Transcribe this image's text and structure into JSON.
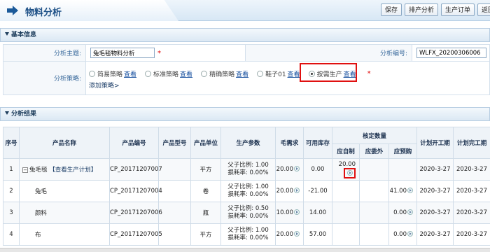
{
  "header": {
    "title": "物料分析",
    "buttons": [
      "保存",
      "排产分析",
      "生产订单",
      "返回"
    ]
  },
  "basic": {
    "section_title": "基本信息",
    "subject_label": "分析主题:",
    "subject_value": "兔毛毯物料分析",
    "code_label": "分析编号:",
    "code_value": "WLFX_20200306006",
    "strategy_label": "分析策略:",
    "strategies": [
      {
        "name": "简易策略",
        "link": "查看",
        "selected": false
      },
      {
        "name": "标准策略",
        "link": "查看",
        "selected": false
      },
      {
        "name": "精确策略",
        "link": "查看",
        "selected": false
      },
      {
        "name": "鞋子01",
        "link": "查看",
        "selected": false
      },
      {
        "name": "按需生产",
        "link": "查看",
        "selected": true
      }
    ],
    "add_strategy": "添加策略>"
  },
  "results": {
    "section_title": "分析结果",
    "headers": {
      "seq": "序号",
      "name": "产品名称",
      "code": "产品编号",
      "model": "产品型号",
      "unit": "产品单位",
      "params": "生产参数",
      "gross": "毛需求",
      "stock": "可用库存",
      "check": "核定数量",
      "self_make": "应自制",
      "outsource": "应委外",
      "purchase": "应预购",
      "plan_start": "计划开工期",
      "plan_end": "计划完工期"
    },
    "rows": [
      {
        "seq": "1",
        "name": "兔毛毯",
        "plan_link": "【查看生产计划】",
        "code": "CP_20171207007",
        "model": "",
        "unit": "平方",
        "ratio": "父子比例: 1.00",
        "loss": "损耗率: 0.00%",
        "gross": "20.00",
        "stock": "0.00",
        "self_make": "20.00",
        "outsource": "",
        "purchase": "",
        "start": "2020-3-27",
        "end": "2020-3-27"
      },
      {
        "seq": "2",
        "name": "兔毛",
        "plan_link": "",
        "code": "CP_20171207004",
        "model": "",
        "unit": "卷",
        "ratio": "父子比例: 1.00",
        "loss": "损耗率: 0.00%",
        "gross": "20.00",
        "stock": "-21.00",
        "self_make": "",
        "outsource": "",
        "purchase": "41.00",
        "start": "2020-3-27",
        "end": "2020-3-27"
      },
      {
        "seq": "3",
        "name": "颜料",
        "plan_link": "",
        "code": "CP_20171207006",
        "model": "",
        "unit": "瓶",
        "ratio": "父子比例: 0.50",
        "loss": "损耗率: 0.00%",
        "gross": "10.00",
        "stock": "14.00",
        "self_make": "",
        "outsource": "",
        "purchase": "0.00",
        "start": "2020-3-27",
        "end": "2020-3-27"
      },
      {
        "seq": "4",
        "name": "布",
        "plan_link": "",
        "code": "CP_20171207005",
        "model": "",
        "unit": "平方",
        "ratio": "父子比例: 1.00",
        "loss": "损耗率: 0.00%",
        "gross": "20.00",
        "stock": "57.00",
        "self_make": "",
        "outsource": "",
        "purchase": "0.00",
        "start": "2020-3-27",
        "end": "2020-3-27"
      }
    ]
  }
}
